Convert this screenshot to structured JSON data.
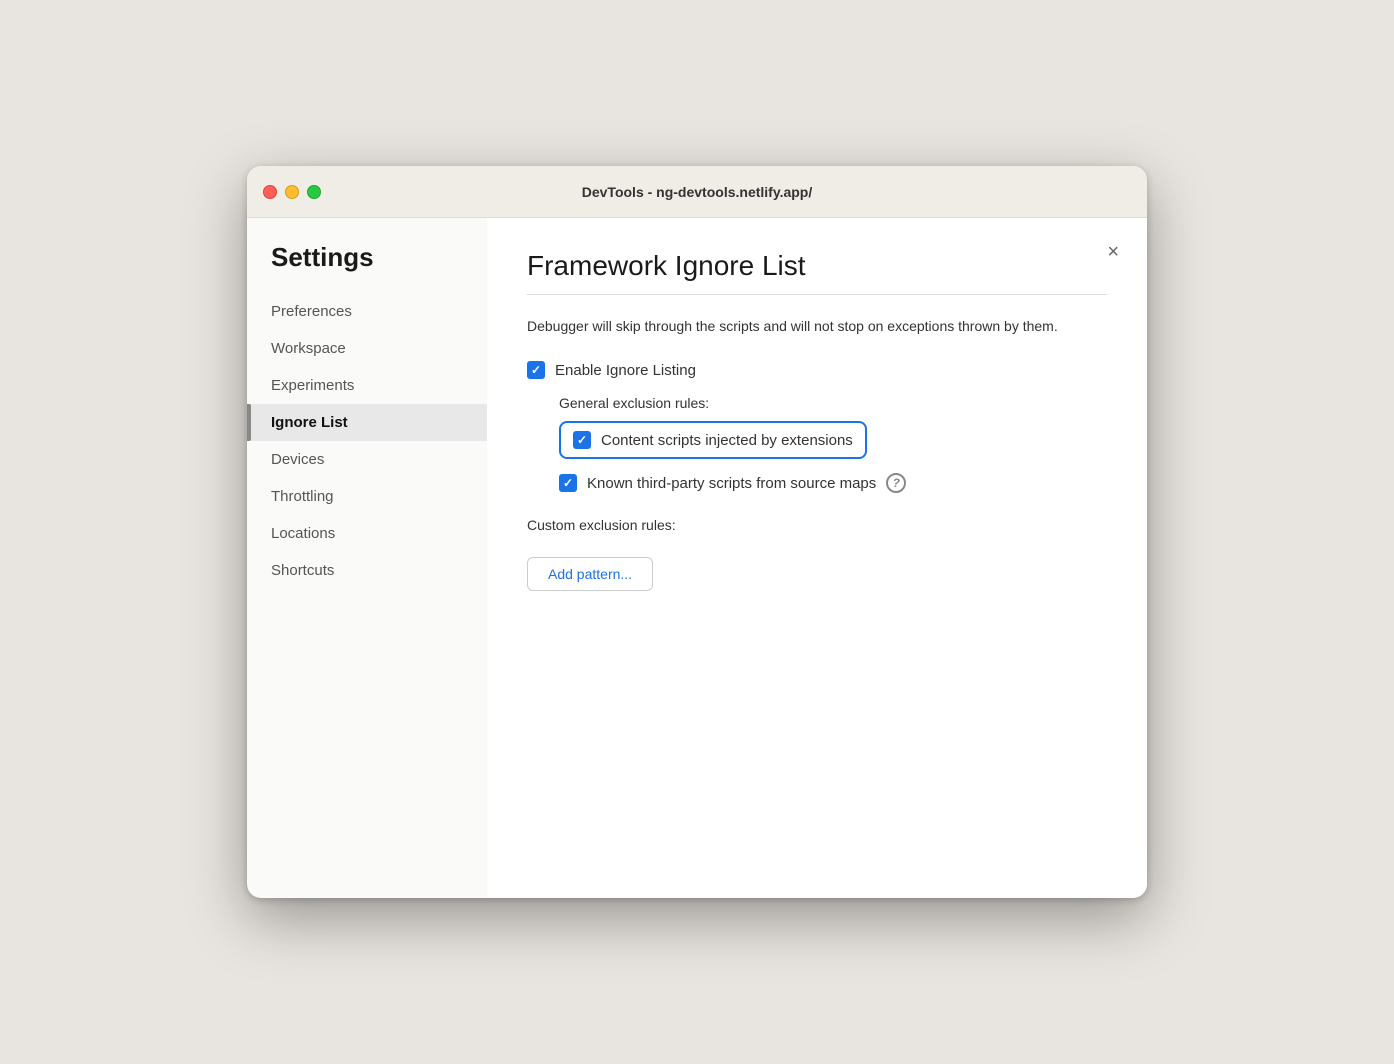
{
  "titlebar": {
    "title": "DevTools - ng-devtools.netlify.app/"
  },
  "sidebar": {
    "heading": "Settings",
    "items": [
      {
        "id": "preferences",
        "label": "Preferences",
        "active": false
      },
      {
        "id": "workspace",
        "label": "Workspace",
        "active": false
      },
      {
        "id": "experiments",
        "label": "Experiments",
        "active": false
      },
      {
        "id": "ignore-list",
        "label": "Ignore List",
        "active": true
      },
      {
        "id": "devices",
        "label": "Devices",
        "active": false
      },
      {
        "id": "throttling",
        "label": "Throttling",
        "active": false
      },
      {
        "id": "locations",
        "label": "Locations",
        "active": false
      },
      {
        "id": "shortcuts",
        "label": "Shortcuts",
        "active": false
      }
    ]
  },
  "main": {
    "title": "Framework Ignore List",
    "description": "Debugger will skip through the scripts and will not stop on exceptions thrown by them.",
    "close_label": "×",
    "enable_ignore_listing": {
      "label": "Enable Ignore Listing",
      "checked": true
    },
    "general_exclusion_rules_label": "General exclusion rules:",
    "rules": [
      {
        "id": "content-scripts",
        "label": "Content scripts injected by extensions",
        "checked": true,
        "highlighted": true,
        "has_info": false
      },
      {
        "id": "third-party-scripts",
        "label": "Known third-party scripts from source maps",
        "checked": true,
        "highlighted": false,
        "has_info": true
      }
    ],
    "custom_exclusion_label": "Custom exclusion rules:",
    "add_pattern_label": "Add pattern...",
    "info_icon_label": "?"
  }
}
